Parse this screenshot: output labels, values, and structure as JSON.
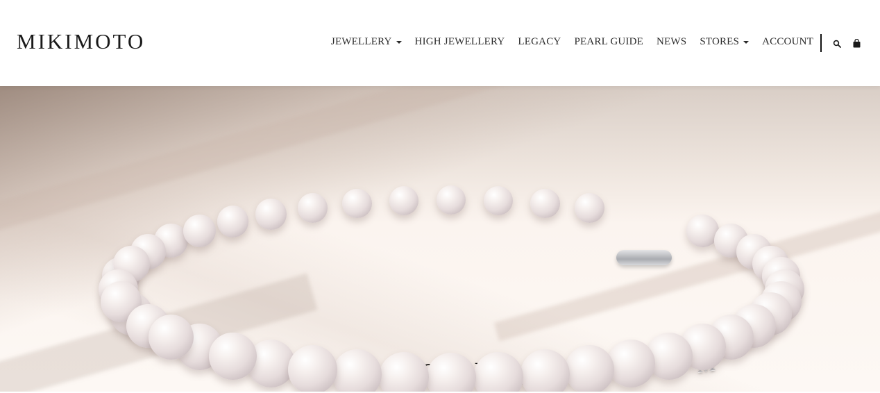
{
  "brand": {
    "logo_text": "MIKIMOTO"
  },
  "nav": {
    "items": [
      {
        "label": "JEWELLERY",
        "has_dropdown": true
      },
      {
        "label": "HIGH JEWELLERY",
        "has_dropdown": false
      },
      {
        "label": "LEGACY",
        "has_dropdown": false
      },
      {
        "label": "PEARL GUIDE",
        "has_dropdown": false
      },
      {
        "label": "NEWS",
        "has_dropdown": false
      },
      {
        "label": "STORES",
        "has_dropdown": true
      },
      {
        "label": "ACCOUNT",
        "has_dropdown": false
      }
    ],
    "icons": [
      "search-icon",
      "shopping-bag-icon"
    ]
  },
  "hero": {
    "title": "White South Sea"
  },
  "colors": {
    "text": "#222222",
    "header_bg": "#ffffff",
    "hero_bg": "#f6eee8"
  }
}
